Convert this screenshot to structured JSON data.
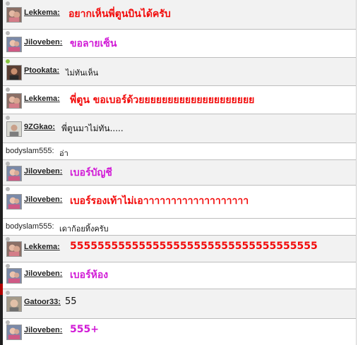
{
  "colors": {
    "red": "#f20a0a",
    "magenta": "#d11bd6",
    "black": "#111111"
  },
  "messages": [
    {
      "user": "Lekkema",
      "text": "อยากเห็นพี่ตูนบินได้ครับ"
    },
    {
      "user": "Jiloveben",
      "text": "ขอลายเซ็น"
    },
    {
      "user": "Ptookata",
      "text": "ไม่ทันเห็น"
    },
    {
      "user": "Lekkema",
      "text": "พี่ตูน ขอเบอร์ด้วยยยยยยยยยยยยยยยยยยยย"
    },
    {
      "user": "9ZGkao",
      "text": "พี่ตูนมาไม่ทัน....."
    },
    {
      "user": "bodyslam555",
      "text": "อ่า"
    },
    {
      "user": "Jiloveben",
      "text": "เบอร์บัญชี"
    },
    {
      "user": "Jiloveben",
      "text": "เบอร์รองเท้าไม่เอาาาาาาาาาาาาาาาาาาา"
    },
    {
      "user": "bodyslam555",
      "text": "เดาก้อยทิ้งครับ"
    },
    {
      "user": "Lekkema",
      "text": "555555555555555555555555555555555555"
    },
    {
      "user": "Jiloveben",
      "text": "เบอร์ห้อง"
    },
    {
      "user": "Gatoor33",
      "text": "55"
    },
    {
      "user": "Jiloveben",
      "text": "555+"
    }
  ]
}
